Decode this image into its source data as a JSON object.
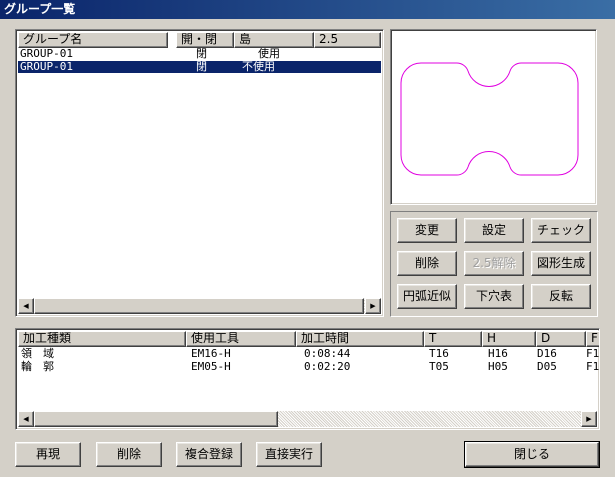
{
  "window": {
    "title": "グループ一覧"
  },
  "group_list": {
    "headers": [
      "グループ名",
      "開・閉",
      "島",
      "2.5"
    ],
    "rows": [
      {
        "name": "GROUP-01",
        "open_close": "閉",
        "island": "使用",
        "selected": false
      },
      {
        "name": "GROUP-01",
        "open_close": "閉",
        "island": "不使用",
        "selected": true
      }
    ]
  },
  "preview": {
    "shape_color": "#e000e0"
  },
  "buttons": {
    "change": "変更",
    "settings": "設定",
    "check": "チェック",
    "delete": "削除",
    "release_25": "2.5解除",
    "generate_shape": "図形生成",
    "arc_approx": "円弧近似",
    "pilot_hole": "下穴表",
    "invert": "反転"
  },
  "process_list": {
    "headers": [
      "加工種類",
      "使用工具",
      "加工時間",
      "T",
      "H",
      "D",
      "F"
    ],
    "rows": [
      {
        "type": "領　域",
        "tool": "EM16-H",
        "time": "0:08:44",
        "t": "T16",
        "h": "H16",
        "d": "D16",
        "f": "F1"
      },
      {
        "type": "輪　郭",
        "tool": "EM05-H",
        "time": "0:02:20",
        "t": "T05",
        "h": "H05",
        "d": "D05",
        "f": "F1"
      }
    ]
  },
  "footer": {
    "replay": "再現",
    "delete": "削除",
    "composite_register": "複合登録",
    "direct_run": "直接実行",
    "close": "閉じる"
  },
  "colors": {
    "selection": "#0a246a",
    "titlebar": "#0a246a"
  }
}
